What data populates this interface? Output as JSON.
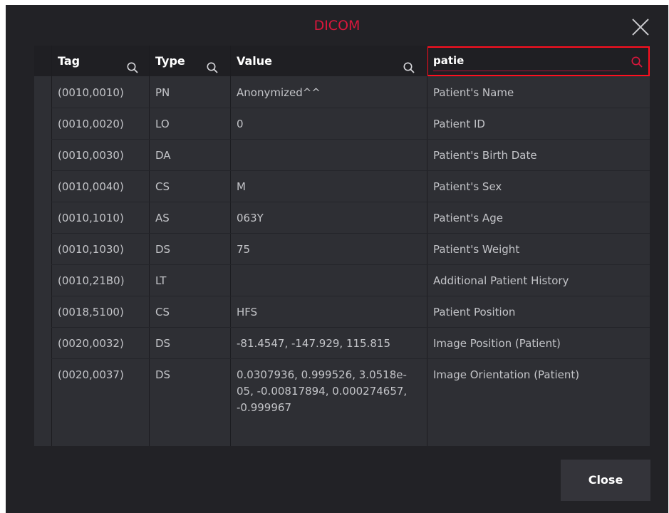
{
  "dialog": {
    "title": "DICOM",
    "close_button_label": "Close"
  },
  "columns": {
    "tag": "Tag",
    "type": "Type",
    "value": "Value",
    "search_value": "patie"
  },
  "rows": [
    {
      "tag": "(0010,0010)",
      "type": "PN",
      "value": "Anonymized^^",
      "name": "Patient's Name"
    },
    {
      "tag": "(0010,0020)",
      "type": "LO",
      "value": "0",
      "name": "Patient ID"
    },
    {
      "tag": "(0010,0030)",
      "type": "DA",
      "value": "",
      "name": "Patient's Birth Date"
    },
    {
      "tag": "(0010,0040)",
      "type": "CS",
      "value": "M",
      "name": "Patient's Sex"
    },
    {
      "tag": "(0010,1010)",
      "type": "AS",
      "value": "063Y",
      "name": "Patient's Age"
    },
    {
      "tag": "(0010,1030)",
      "type": "DS",
      "value": "75",
      "name": "Patient's Weight"
    },
    {
      "tag": "(0010,21B0)",
      "type": "LT",
      "value": "",
      "name": "Additional Patient History"
    },
    {
      "tag": "(0018,5100)",
      "type": "CS",
      "value": "HFS",
      "name": "Patient Position"
    },
    {
      "tag": "(0020,0032)",
      "type": "DS",
      "value": "-81.4547, -147.929, 115.815",
      "name": "Image Position (Patient)"
    },
    {
      "tag": "(0020,0037)",
      "type": "DS",
      "value": "0.0307936, 0.999526, 3.0518e-05, -0.00817894, 0.000274657, -0.999967",
      "name": "Image Orientation (Patient)"
    }
  ],
  "colors": {
    "title": "#d9173c",
    "search_highlight": "#ff0f1f",
    "search_icon": "#d9173c"
  }
}
